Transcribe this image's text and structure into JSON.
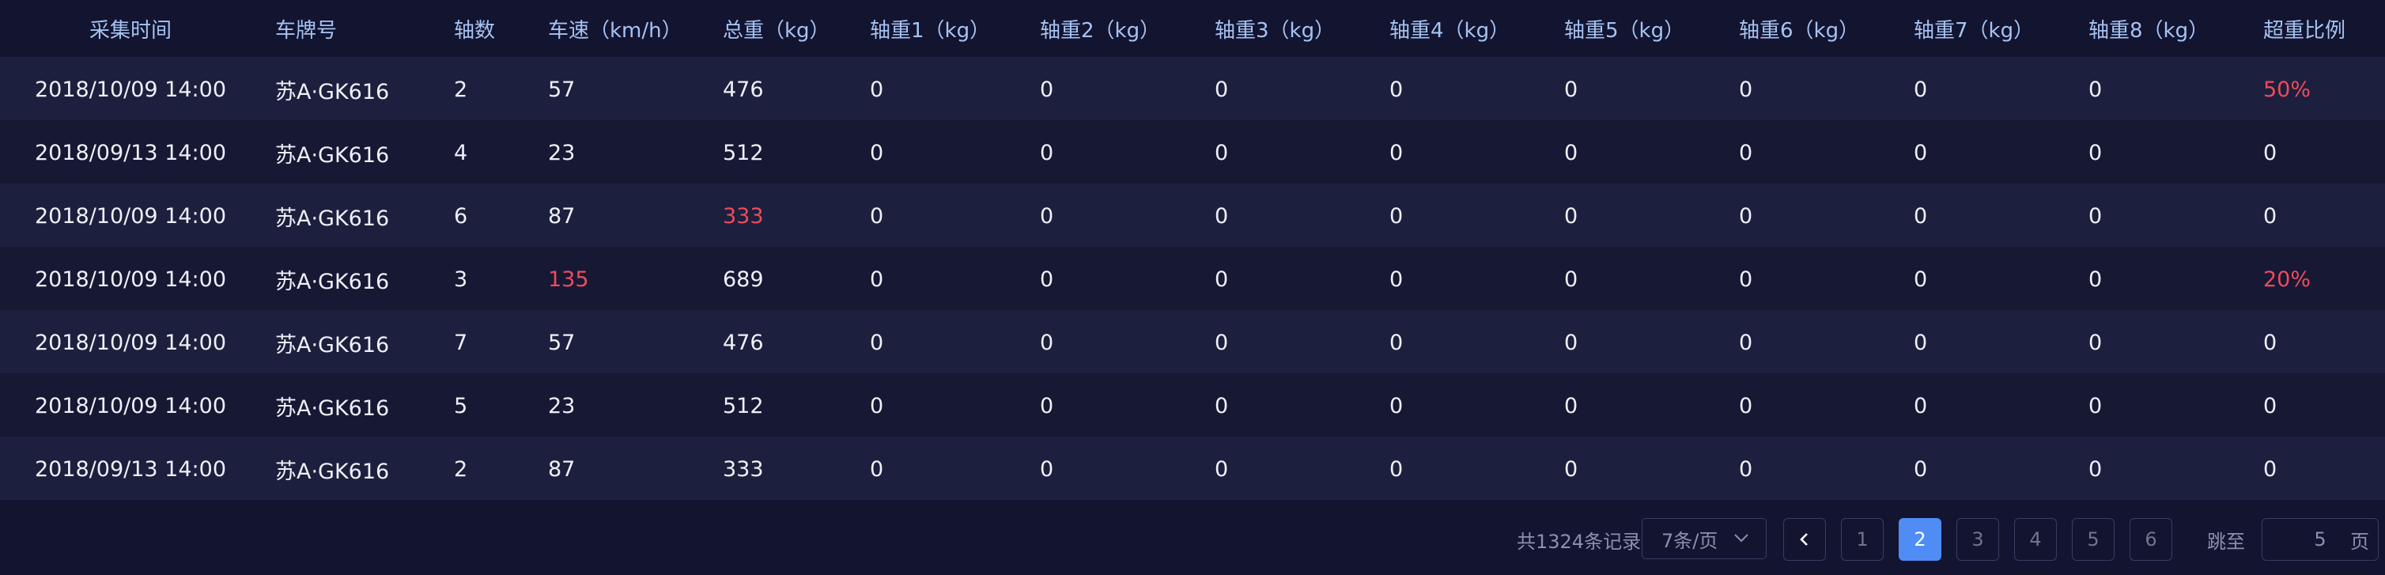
{
  "table": {
    "columns": [
      "采集时间",
      "车牌号",
      "轴数",
      "车速（km/h）",
      "总重（kg）",
      "轴重1（kg）",
      "轴重2（kg）",
      "轴重3（kg）",
      "轴重4（kg）",
      "轴重5（kg）",
      "轴重6（kg）",
      "轴重7（kg）",
      "轴重8（kg）",
      "超重比例"
    ],
    "rows": [
      [
        "2018/10/09 14:00",
        "苏A·GK616",
        "2",
        "57",
        "476",
        "0",
        "0",
        "0",
        "0",
        "0",
        "0",
        "0",
        "0",
        "50%"
      ],
      [
        "2018/09/13 14:00",
        "苏A·GK616",
        "4",
        "23",
        "512",
        "0",
        "0",
        "0",
        "0",
        "0",
        "0",
        "0",
        "0",
        "0"
      ],
      [
        "2018/10/09 14:00",
        "苏A·GK616",
        "6",
        "87",
        "333",
        "0",
        "0",
        "0",
        "0",
        "0",
        "0",
        "0",
        "0",
        "0"
      ],
      [
        "2018/10/09 14:00",
        "苏A·GK616",
        "3",
        "135",
        "689",
        "0",
        "0",
        "0",
        "0",
        "0",
        "0",
        "0",
        "0",
        "20%"
      ],
      [
        "2018/10/09 14:00",
        "苏A·GK616",
        "7",
        "57",
        "476",
        "0",
        "0",
        "0",
        "0",
        "0",
        "0",
        "0",
        "0",
        "0"
      ],
      [
        "2018/10/09 14:00",
        "苏A·GK616",
        "5",
        "23",
        "512",
        "0",
        "0",
        "0",
        "0",
        "0",
        "0",
        "0",
        "0",
        "0"
      ],
      [
        "2018/09/13 14:00",
        "苏A·GK616",
        "2",
        "87",
        "333",
        "0",
        "0",
        "0",
        "0",
        "0",
        "0",
        "0",
        "0",
        "0"
      ]
    ],
    "alert_cells": [
      [
        0,
        13
      ],
      [
        2,
        4
      ],
      [
        3,
        3
      ],
      [
        3,
        13
      ]
    ],
    "colors": {
      "alert": "#ee4b5a",
      "header_text": "#a5c3f2",
      "accent": "#4f8df5"
    }
  },
  "pagination": {
    "total_text": "共1324条记录",
    "page_size": "7条/页",
    "prev_icon": "chevron-left-icon",
    "size_icon": "chevron-down-icon",
    "pages": [
      "1",
      "2",
      "3",
      "4",
      "5",
      "6"
    ],
    "current_page": "2",
    "jump_label": "跳至",
    "jump_value": "5",
    "page_label": "页"
  }
}
